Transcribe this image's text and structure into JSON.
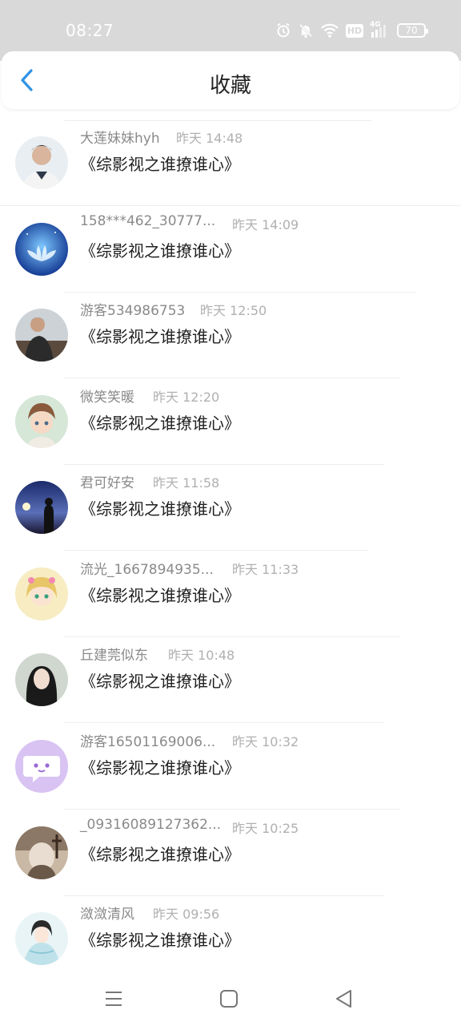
{
  "status_bar": {
    "time": "08:27",
    "hd_label": "HD",
    "signal_label": "4G",
    "battery": "70"
  },
  "header": {
    "back_icon": "chevron-left-icon",
    "title": "收藏"
  },
  "favorites": [
    {
      "user": "大莲妹妹hyh",
      "time": "昨天 14:48",
      "title": "《综影视之谁撩谁心》"
    },
    {
      "user": "158***462_30777...",
      "time": "昨天 14:09",
      "title": "《综影视之谁撩谁心》"
    },
    {
      "user": "游客534986753",
      "time": "昨天 12:50",
      "title": "《综影视之谁撩谁心》"
    },
    {
      "user": "微笑笑暖",
      "time": "昨天 12:20",
      "title": "《综影视之谁撩谁心》"
    },
    {
      "user": "君可好安",
      "time": "昨天 11:58",
      "title": "《综影视之谁撩谁心》"
    },
    {
      "user": "流光_1667894935...",
      "time": "昨天 11:33",
      "title": "《综影视之谁撩谁心》"
    },
    {
      "user": "丘建莞似东",
      "time": "昨天 10:48",
      "title": "《综影视之谁撩谁心》"
    },
    {
      "user": "游客16501169006...",
      "time": "昨天 10:32",
      "title": "《综影视之谁撩谁心》"
    },
    {
      "user": "_09316089127362...",
      "time": "昨天 10:25",
      "title": "《综影视之谁撩谁心》"
    },
    {
      "user": "潋潋清风",
      "time": "昨天 09:56",
      "title": "《综影视之谁撩谁心》"
    }
  ],
  "bottom_nav": {
    "icons": [
      "menu-icon",
      "home-square-icon",
      "back-triangle-icon"
    ]
  }
}
